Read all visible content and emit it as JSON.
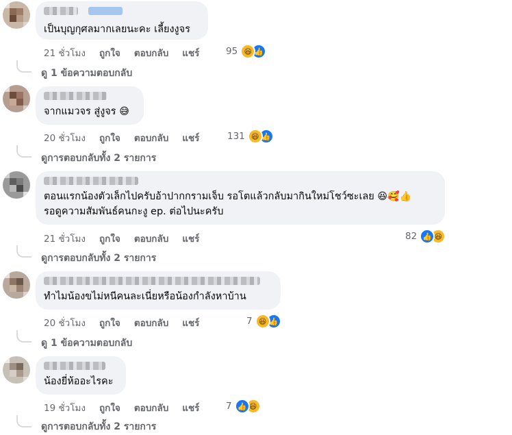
{
  "comments": [
    {
      "text": "เป็นบุญกุศลมากเลยนะคะ เลี้ยงงูจร",
      "time": "21 ชั่วโมง",
      "like": "ถูกใจ",
      "reply": "ตอบกลับ",
      "share": "แชร์",
      "reaction_count": "95",
      "reactions": [
        "laugh-icon",
        "like-icon"
      ],
      "replies_link": "ดู 1 ข้อความตอบกลับ"
    },
    {
      "text": "จากแมวจร สู่งูจร",
      "emoji": "😅",
      "time": "20 ชั่วโมง",
      "like": "ถูกใจ",
      "reply": "ตอบกลับ",
      "share": "แชร์",
      "reaction_count": "131",
      "reactions": [
        "laugh-icon",
        "like-icon"
      ],
      "replies_link": "ดูการตอบกลับทั้ง 2 รายการ"
    },
    {
      "text_line1": "ตอนแรกน้องตัวเล็กไปครับอ้าปากกรามเจ็บ รอโตแล้วกลับมากินใหม่โชว์ซะเลย",
      "emoji": "😆🥰👍",
      "text_line2": "รอดูความสัมพันธ์คนกะงู ep. ต่อไปนะครับ",
      "time": "21 ชั่วโมง",
      "like": "ถูกใจ",
      "reply": "ตอบกลับ",
      "share": "แชร์",
      "reaction_count": "82",
      "reactions": [
        "like-icon",
        "laugh-icon"
      ],
      "replies_link": "ดูการตอบกลับทั้ง 2 รายการ"
    },
    {
      "text": "ทำไมน้องขไม่หนีคนละเนี่ยหรือน้องกำลังหาบ้าน",
      "time": "20 ชั่วโมง",
      "like": "ถูกใจ",
      "reply": "ตอบกลับ",
      "share": "แชร์",
      "reaction_count": "7",
      "reactions": [
        "laugh-icon",
        "like-icon"
      ],
      "replies_link": "ดู 1 ข้อความตอบกลับ"
    },
    {
      "text": "น้องยี่ห้ออะไรคะ",
      "time": "19 ชั่วโมง",
      "like": "ถูกใจ",
      "reply": "ตอบกลับ",
      "share": "แชร์",
      "reaction_count": "7",
      "reactions": [
        "like-icon",
        "laugh-icon"
      ],
      "replies_link": "ดูการตอบกลับทั้ง 2 รายการ"
    }
  ],
  "colors": {
    "bubble": "#f0f2f5",
    "meta": "#65676b",
    "like_blue": "#1877f2",
    "laugh_yellow": "#f7b928"
  }
}
